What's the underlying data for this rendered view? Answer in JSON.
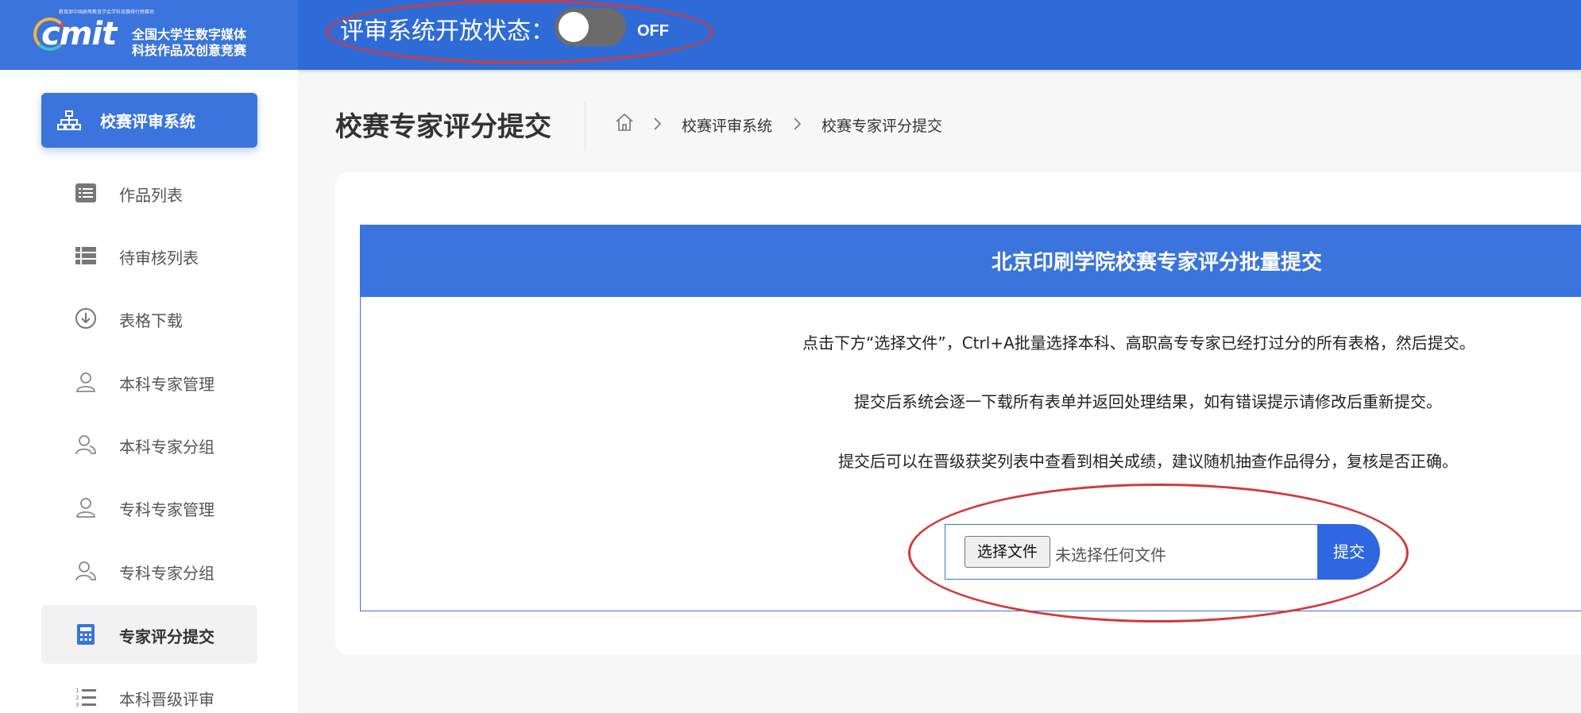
{
  "header": {
    "logo_small": "教育部中国高等教育学会学科竞赛排行榜赛项",
    "logo_wordmark": "cmit",
    "logo_line1": "全国大学生数字媒体",
    "logo_line2": "科技作品及创意竞赛",
    "status_label": "评审系统开放状态：",
    "toggle_state": "OFF"
  },
  "sidebar": {
    "top_item": "校赛评审系统",
    "items": [
      {
        "label": "作品列表",
        "icon": "list-box-icon"
      },
      {
        "label": "待审核列表",
        "icon": "grid-list-icon"
      },
      {
        "label": "表格下载",
        "icon": "download-circle-icon"
      },
      {
        "label": "本科专家管理",
        "icon": "user-icon"
      },
      {
        "label": "本科专家分组",
        "icon": "users-icon"
      },
      {
        "label": "专科专家管理",
        "icon": "user-icon"
      },
      {
        "label": "专科专家分组",
        "icon": "users-icon"
      },
      {
        "label": "专家评分提交",
        "icon": "calculator-icon",
        "active": true
      },
      {
        "label": "本科晋级评审",
        "icon": "numbered-list-icon"
      }
    ]
  },
  "main": {
    "page_title": "校赛专家评分提交",
    "breadcrumb": [
      "校赛评审系统",
      "校赛专家评分提交"
    ],
    "panel_title": "北京印刷学院校赛专家评分批量提交",
    "notes": [
      "点击下方“选择文件”，Ctrl+A批量选择本科、高职高专专家已经打过分的所有表格，然后提交。",
      "提交后系统会逐一下载所有表单并返回处理结果，如有错误提示请修改后重新提交。",
      "提交后可以在晋级获奖列表中查看到相关成绩，建议随机抽查作品得分，复核是否正确。"
    ],
    "file_button": "选择文件",
    "file_status": "未选择任何文件",
    "submit_label": "提交"
  },
  "colors": {
    "primary": "#3a74dc",
    "header": "#2f6bd6",
    "annotation": "#d23a3a"
  }
}
